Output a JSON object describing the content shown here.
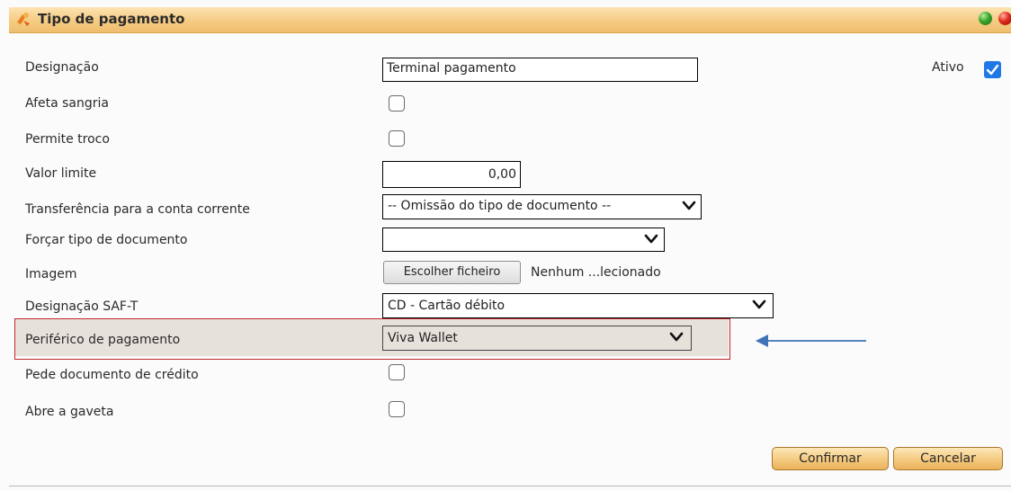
{
  "dialog": {
    "title": "Tipo de pagamento",
    "title_icon": "payment-type-icon"
  },
  "form": {
    "designacao": {
      "label": "Designação",
      "value": "Terminal pagamento"
    },
    "ativo": {
      "label": "Ativo",
      "checked": true
    },
    "afeta_sangria": {
      "label": "Afeta sangria",
      "checked": false
    },
    "permite_troco": {
      "label": "Permite troco",
      "checked": false
    },
    "valor_limite": {
      "label": "Valor limite",
      "value": "0,00"
    },
    "transferencia": {
      "label": "Transferência para a conta corrente",
      "selected": "-- Omissão do tipo de documento --"
    },
    "forcar_tipo": {
      "label": "Forçar tipo de documento",
      "selected": ""
    },
    "imagem": {
      "label": "Imagem",
      "button": "Escolher ficheiro",
      "file_status": "Nenhum ...lecionado"
    },
    "saft": {
      "label": "Designação SAF-T",
      "selected": "CD - Cartão débito"
    },
    "periferico": {
      "label": "Periférico de pagamento",
      "selected": "Viva Wallet"
    },
    "pede_credito": {
      "label": "Pede documento de crédito",
      "checked": false
    },
    "abre_gaveta": {
      "label": "Abre a gaveta",
      "checked": false
    }
  },
  "actions": {
    "confirm": "Confirmar",
    "cancel": "Cancelar"
  },
  "annotation": {
    "highlight_color": "#c4262e",
    "arrow_color": "#3f74b8"
  },
  "colors": {
    "title_bar": "#f5cb83",
    "checkbox_checked": "#1f78e6",
    "button": "#f3c77a"
  }
}
